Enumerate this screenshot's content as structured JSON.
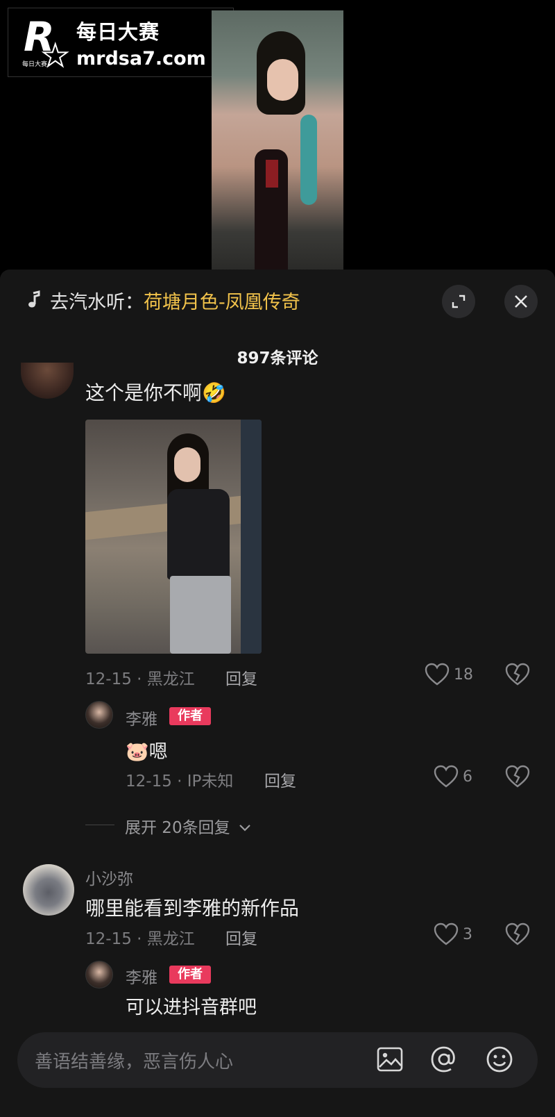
{
  "watermark": {
    "brand_cn": "每日大赛",
    "url": "mrdsa7.com",
    "logo_letter": "R",
    "logo_mini": "每日大赛"
  },
  "music": {
    "prefix": "去汽水听：",
    "song": "荷塘月色-凤凰传奇"
  },
  "comments_header": {
    "count": "897条评论"
  },
  "comments": [
    {
      "text": "这个是你不啊",
      "emoji": "🤣",
      "meta": "12-15 · 黑龙江",
      "reply_label": "回复",
      "likes": "18",
      "replies": [
        {
          "username": "李雅",
          "badge": "作者",
          "emoji": "🐷",
          "text": "嗯",
          "meta": "12-15 · IP未知",
          "reply_label": "回复",
          "likes": "6"
        }
      ],
      "expand_label": "展开 20条回复"
    },
    {
      "username": "小沙弥",
      "text": "哪里能看到李雅的新作品",
      "meta": "12-15 · 黑龙江",
      "reply_label": "回复",
      "likes": "3",
      "replies": [
        {
          "username": "李雅",
          "badge": "作者",
          "text": "可以进抖音群吧"
        }
      ]
    }
  ],
  "input": {
    "placeholder": "善语结善缘，恶言伤人心"
  },
  "icons": {
    "music": "music-note-icon",
    "expand": "expand-icon",
    "close": "close-icon",
    "like": "heart-icon",
    "dislike": "broken-heart-icon",
    "image": "image-icon",
    "mention": "at-icon",
    "emoji": "smiley-icon"
  },
  "colors": {
    "panel": "#161616",
    "accent_song": "#f2c34b",
    "author_badge": "#e93a5d"
  }
}
